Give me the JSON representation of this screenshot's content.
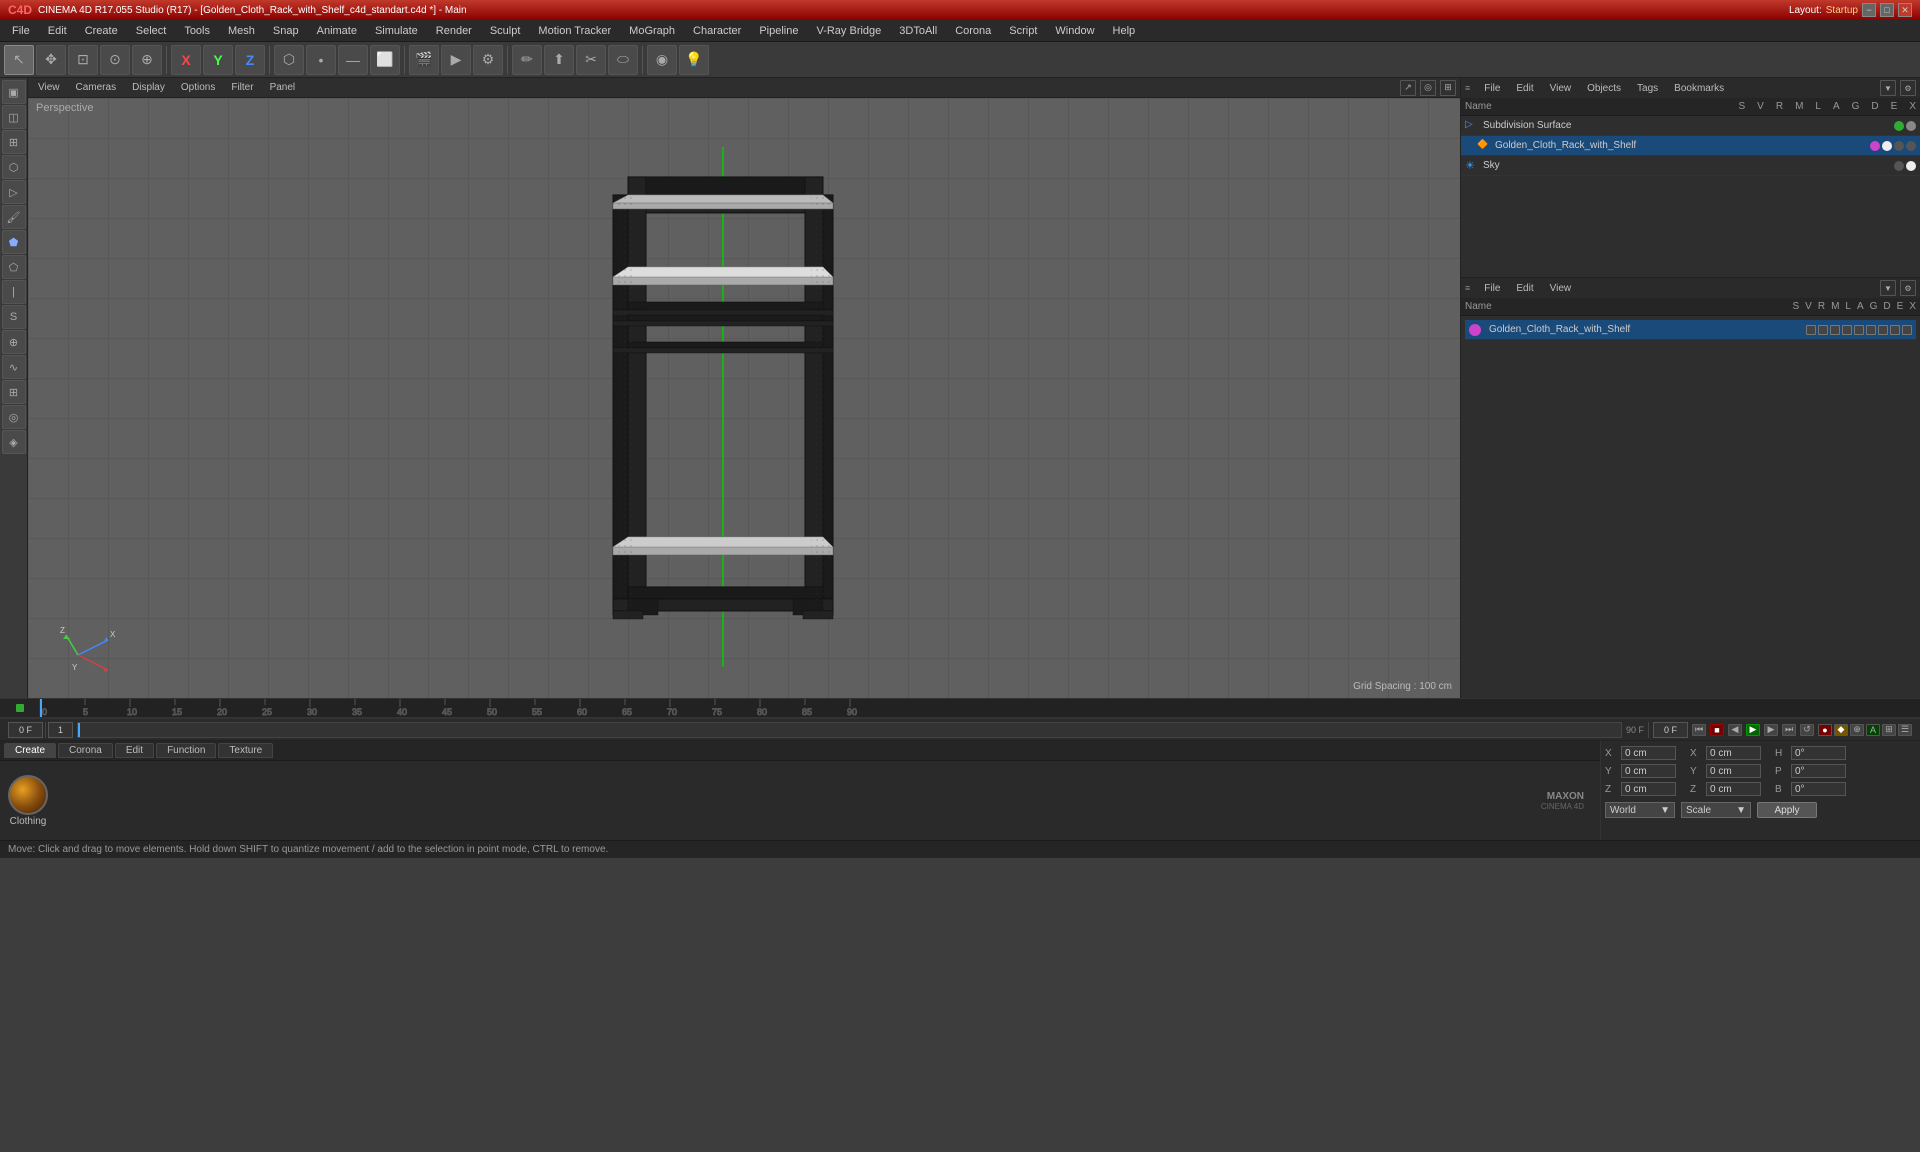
{
  "titlebar": {
    "title": "CINEMA 4D R17.055 Studio (R17) - [Golden_Cloth_Rack_with_Shelf_c4d_standart.c4d *] - Main",
    "layout_label": "Layout:",
    "layout_value": "Startup",
    "minimize": "−",
    "maximize": "□",
    "close": "✕"
  },
  "menubar": {
    "items": [
      "File",
      "Edit",
      "Create",
      "Select",
      "Tools",
      "Mesh",
      "Snap",
      "Animate",
      "Simulate",
      "Render",
      "Sculpt",
      "Motion Tracker",
      "MoGraph",
      "Character",
      "Pipeline",
      "V-Ray Bridge",
      "3DToAll",
      "Corona",
      "Script",
      "Window",
      "Help"
    ]
  },
  "toolbar": {
    "tools": [
      "↖",
      "✥",
      "⬚",
      "⊙",
      "⊕",
      "X",
      "Y",
      "Z",
      "⬡",
      "⬜",
      "⬜",
      "⬜",
      "⬜",
      "⬜",
      "⬜",
      "⬜",
      "⬜",
      "⬜",
      "⬜",
      "⬜",
      "⬜",
      "⬜",
      "⬜",
      "⬜",
      "⬜"
    ]
  },
  "viewport": {
    "menu_items": [
      "View",
      "Cameras",
      "Display",
      "Options",
      "Filter",
      "Panel"
    ],
    "perspective_label": "Perspective",
    "grid_spacing": "Grid Spacing : 100 cm",
    "corner_buttons": [
      "↗↙",
      "◎",
      "⊞"
    ]
  },
  "object_manager": {
    "menu_items": [
      "File",
      "Edit",
      "View",
      "Objects",
      "Tags",
      "Bookmarks"
    ],
    "columns": [
      "Name",
      "S",
      "V",
      "R",
      "M",
      "L",
      "A",
      "G",
      "D",
      "E",
      "X"
    ],
    "objects": [
      {
        "indent": 0,
        "icon": "🔷",
        "name": "Subdivision Surface",
        "color": "#33cc33",
        "checks": [
          "●",
          "●"
        ]
      },
      {
        "indent": 1,
        "icon": "🔶",
        "name": "Golden_Cloth_Rack_with_Shelf",
        "color": "#cc44cc",
        "checks": [
          "●",
          "●"
        ]
      },
      {
        "indent": 0,
        "icon": "☀",
        "name": "Sky",
        "color": "#3399ff",
        "checks": [
          "●",
          "●"
        ]
      }
    ]
  },
  "attributes_manager": {
    "menu_items": [
      "File",
      "Edit",
      "View"
    ],
    "columns": [
      "Name",
      "S",
      "V",
      "R",
      "M",
      "L",
      "A",
      "G",
      "D",
      "E",
      "X"
    ],
    "selected_object": "Golden_Cloth_Rack_with_Shelf",
    "icon_colors": [
      "#cc44cc",
      "#3399ff",
      "#aaaaaa",
      "#aaaaaa",
      "#aaaaaa",
      "#aaaaaa",
      "#aaaaaa",
      "#aaaaaa",
      "#aaaaaa"
    ]
  },
  "timeline": {
    "start_frame": "0 F",
    "end_frame": "90 F",
    "current_frame": "0 F",
    "marks": [
      0,
      5,
      10,
      15,
      20,
      25,
      30,
      35,
      40,
      45,
      50,
      55,
      60,
      65,
      70,
      75,
      80,
      85,
      90
    ],
    "transport_buttons": [
      "⏮",
      "⏭",
      "▶",
      "⏹",
      "⏺"
    ],
    "playback_buttons": [
      "⏮",
      "⏪",
      "◀",
      "■",
      "▶",
      "⏩",
      "⏭",
      "↺"
    ]
  },
  "material_panel": {
    "tabs": [
      "Create",
      "Corona",
      "Edit",
      "Function",
      "Texture"
    ],
    "active_tab": "Create",
    "material_name": "Clothing",
    "material_color": "#e8a020"
  },
  "coords": {
    "x_pos": "0 cm",
    "y_pos": "0 cm",
    "z_pos": "0 cm",
    "x_scale": "0 cm",
    "y_scale": "0 cm",
    "z_scale": "0 cm",
    "h_rot": "0°",
    "p_rot": "0°",
    "b_rot": "0°",
    "world_label": "World",
    "apply_label": "Apply"
  },
  "status_bar": {
    "message": "Move: Click and drag to move elements. Hold down SHIFT to quantize movement / add to the selection in point mode, CTRL to remove."
  },
  "playback_controls": {
    "buttons": [
      {
        "icon": "⏮",
        "name": "go-to-start"
      },
      {
        "icon": "⏹",
        "name": "stop",
        "style": "red"
      },
      {
        "icon": "▶",
        "name": "play"
      },
      {
        "icon": "⏸",
        "name": "pause"
      },
      {
        "icon": "⏩",
        "name": "fast-forward"
      },
      {
        "icon": "⏭",
        "name": "go-to-end"
      },
      {
        "icon": "↺",
        "name": "loop"
      }
    ],
    "extra_buttons": [
      "🔴",
      "🟡",
      "⚙",
      "☁",
      "◉",
      "⊞",
      "☰"
    ]
  }
}
